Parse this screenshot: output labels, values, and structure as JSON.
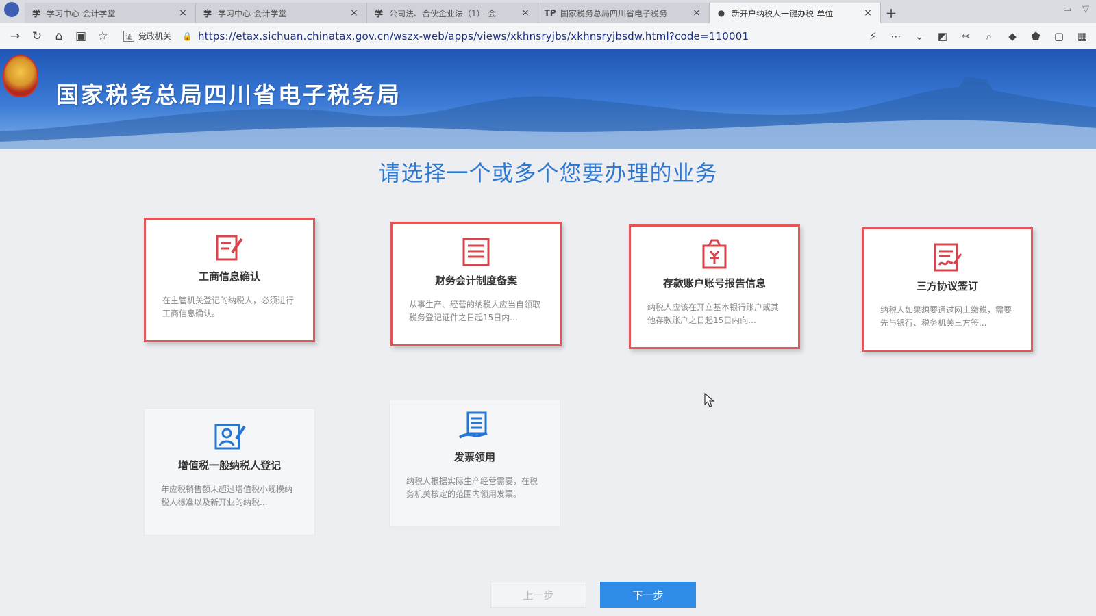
{
  "browser": {
    "tabs": [
      {
        "label": "学习中心-会计学堂",
        "favicon": "学",
        "active": false
      },
      {
        "label": "学习中心-会计学堂",
        "favicon": "学",
        "active": false
      },
      {
        "label": "公司法、合伙企业法（1）-会",
        "favicon": "学",
        "active": false
      },
      {
        "label": "国家税务总局四川省电子税务",
        "favicon": "TP",
        "active": false
      },
      {
        "label": "新开户纳税人一键办税-单位",
        "favicon": "●",
        "active": true
      }
    ],
    "new_tab": "+",
    "close_glyph": "×",
    "bookmark_label": "党政机关",
    "bookmark_icon": "证",
    "url": "https://etax.sichuan.chinatax.gov.cn/wszx-web/apps/views/xkhnsryjbs/xkhnsryjbsdw.html?code=110001"
  },
  "banner": {
    "title": "国家税务总局四川省电子税务局"
  },
  "main": {
    "heading": "请选择一个或多个您要办理的业务",
    "cards": [
      {
        "title": "工商信息确认",
        "desc": "在主管机关登记的纳税人，必须进行工商信息确认。",
        "icon": "edit-document-icon",
        "selected": true
      },
      {
        "title": "财务会计制度备案",
        "desc": "从事生产、经营的纳税人应当自领取税务登记证件之日起15日内...",
        "icon": "list-document-icon",
        "selected": true
      },
      {
        "title": "存款账户账号报告信息",
        "desc": "纳税人应该在开立基本银行账户或其他存款账户之日起15日内向...",
        "icon": "money-bag-icon",
        "selected": true
      },
      {
        "title": "三方协议签订",
        "desc": "纳税人如果想要通过网上缴税，需要先与银行、税务机关三方签...",
        "icon": "signed-document-icon",
        "selected": true
      },
      {
        "title": "增值税一般纳税人登记",
        "desc": "年应税销售额未超过增值税小规模纳税人标准以及新开业的纳税...",
        "icon": "person-register-icon",
        "selected": false
      },
      {
        "title": "发票领用",
        "desc": "纳税人根据实际生产经营需要，在税务机关核定的范围内领用发票。",
        "icon": "invoice-hand-icon",
        "selected": false
      }
    ],
    "prev_label": "上一步",
    "next_label": "下一步"
  },
  "colors": {
    "accent": "#2f8be6",
    "selected_border": "#e4555a",
    "heading": "#2f78cf"
  }
}
